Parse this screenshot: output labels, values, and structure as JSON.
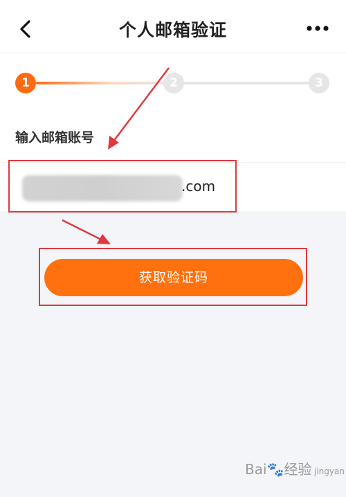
{
  "header": {
    "title": "个人邮箱验证",
    "back_icon": "chevron-left-icon",
    "more_icon": "more-dots-icon"
  },
  "steps": [
    {
      "number": "1",
      "state": "active"
    },
    {
      "number": "2",
      "state": "inactive"
    },
    {
      "number": "3",
      "state": "inactive"
    }
  ],
  "form": {
    "section_label": "输入邮箱账号",
    "email_suffix": ".com"
  },
  "actions": {
    "primary_label": "获取验证码"
  },
  "annotations": {
    "highlight_color": "#e0383e"
  },
  "watermark": {
    "brand": "Bai",
    "paw": "🐾",
    "suffix": "经验",
    "sub": "jingyan"
  },
  "colors": {
    "accent": "#ff6a13",
    "button": "#ff700f",
    "inactive": "#e6e6e6"
  }
}
